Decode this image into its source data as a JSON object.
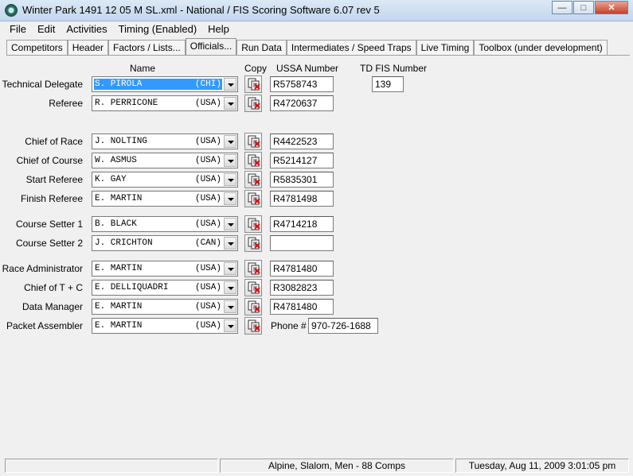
{
  "window": {
    "title": "Winter Park 1491 12 05 M SL.xml - National / FIS Scoring Software 6.07 rev 5"
  },
  "menu": [
    "File",
    "Edit",
    "Activities",
    "Timing (Enabled)",
    "Help"
  ],
  "tabs": [
    "Competitors",
    "Header",
    "Factors / Lists...",
    "Officials...",
    "Run Data",
    "Intermediates / Speed Traps",
    "Live Timing",
    "Toolbox (under development)"
  ],
  "active_tab": "Officials...",
  "columns": {
    "name": "Name",
    "copy": "Copy",
    "ussa": "USSA Number",
    "td_fis": "TD FIS Number"
  },
  "td_fis_number": "139",
  "officials": [
    {
      "role": "Technical Delegate",
      "name": "S. PIROLA",
      "nation": "(CHI)",
      "ussa": "R5758743",
      "selected": true
    },
    {
      "role": "Referee",
      "name": "R. PERRICONE",
      "nation": "(USA)",
      "ussa": "R4720637"
    },
    {
      "role": "Chief of Race",
      "name": "J. NOLTING",
      "nation": "(USA)",
      "ussa": "R4422523"
    },
    {
      "role": "Chief of Course",
      "name": "W. ASMUS",
      "nation": "(USA)",
      "ussa": "R5214127"
    },
    {
      "role": "Start Referee",
      "name": "K. GAY",
      "nation": "(USA)",
      "ussa": "R5835301"
    },
    {
      "role": "Finish Referee",
      "name": "E. MARTIN",
      "nation": "(USA)",
      "ussa": "R4781498"
    },
    {
      "role": "Course Setter 1",
      "name": "B. BLACK",
      "nation": "(USA)",
      "ussa": "R4714218"
    },
    {
      "role": "Course Setter 2",
      "name": "J. CRICHTON",
      "nation": "(CAN)",
      "ussa": ""
    },
    {
      "role": "Race Administrator",
      "name": "E. MARTIN",
      "nation": "(USA)",
      "ussa": "R4781480"
    },
    {
      "role": "Chief of T + C",
      "name": "E. DELLIQUADRI",
      "nation": "(USA)",
      "ussa": "R3082823"
    },
    {
      "role": "Data Manager",
      "name": "E. MARTIN",
      "nation": "(USA)",
      "ussa": "R4781480"
    },
    {
      "role": "Packet Assembler",
      "name": "E. MARTIN",
      "nation": "(USA)",
      "phone_label": "Phone #",
      "phone": "970-726-1688"
    }
  ],
  "status": {
    "left": "",
    "center": "Alpine, Slalom, Men - 88 Comps",
    "right": "Tuesday, Aug 11, 2009  3:01:05 pm"
  },
  "colors": {
    "selection": "#3399ff",
    "close_button": "#c7412a"
  },
  "icons": {
    "copy": "copy-paste-icon",
    "app": "app-icon"
  }
}
